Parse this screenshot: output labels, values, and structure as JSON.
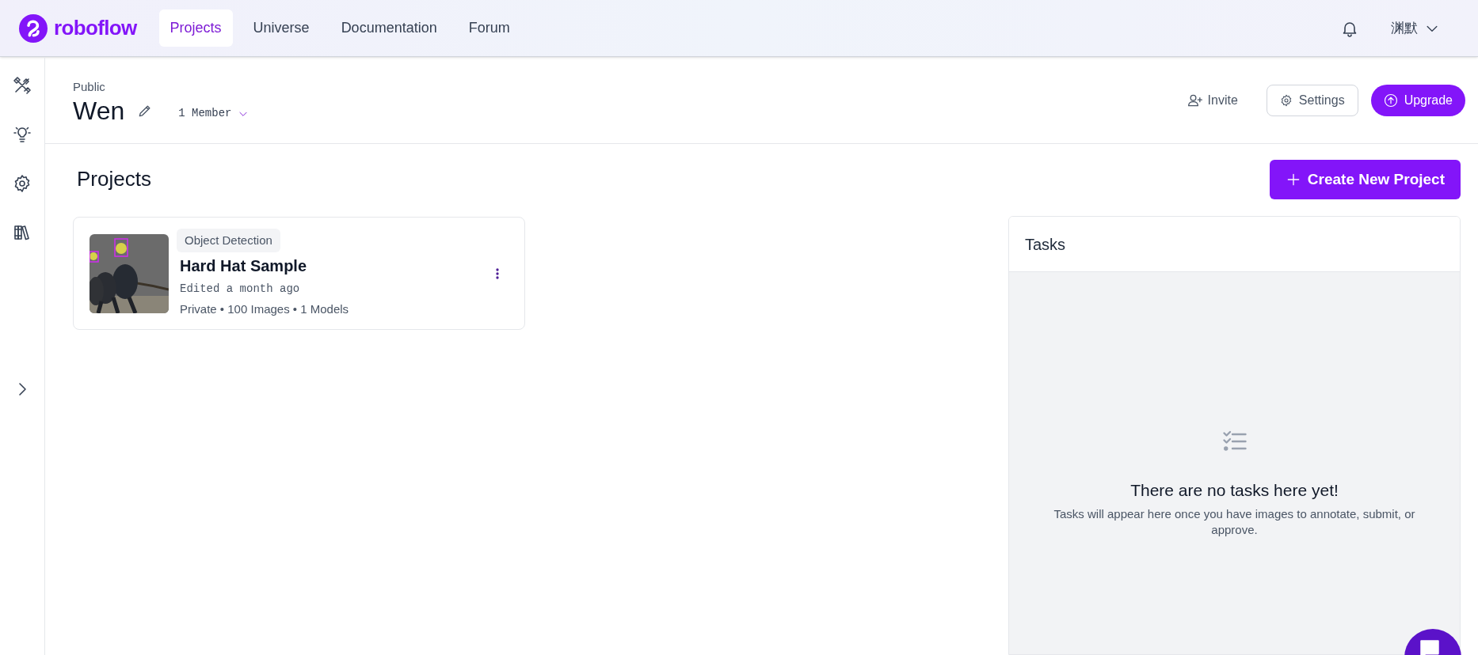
{
  "brand": {
    "name": "roboflow"
  },
  "nav": [
    {
      "label": "Projects",
      "selected": true
    },
    {
      "label": "Universe",
      "selected": false
    },
    {
      "label": "Documentation",
      "selected": false
    },
    {
      "label": "Forum",
      "selected": false
    }
  ],
  "user": {
    "name": "渊默"
  },
  "sidebar": {
    "items": [
      {
        "kind": "tools"
      },
      {
        "kind": "ideas"
      },
      {
        "kind": "settings"
      },
      {
        "kind": "library"
      }
    ]
  },
  "workspace": {
    "visibility": "Public",
    "name": "Wen",
    "members": "1 Member"
  },
  "actions": [
    {
      "kind": "invite",
      "label": "Invite"
    },
    {
      "kind": "settings",
      "label": "Settings"
    },
    {
      "kind": "upgrade",
      "label": "Upgrade"
    }
  ],
  "projects": {
    "title": "Projects",
    "create_button": "Create New Project",
    "items": [
      {
        "type": "Object Detection",
        "name": "Hard Hat Sample",
        "edited": "Edited a month ago",
        "meta": "Private • 100 Images • 1 Models"
      }
    ]
  },
  "tasks": {
    "title": "Tasks",
    "empty_title": "There are no tasks here yet!",
    "empty_text": "Tasks will appear here once you have images to annotate, submit, or approve."
  }
}
